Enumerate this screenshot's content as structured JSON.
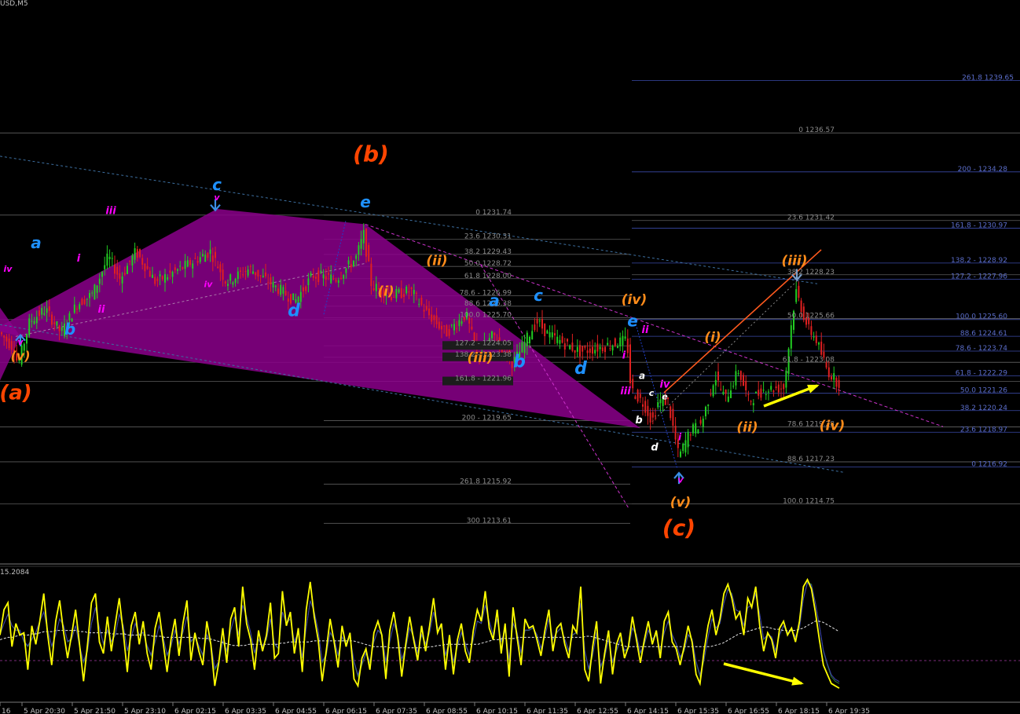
{
  "header": {
    "symbol": "USD,M5",
    "osc_value": "15.2084"
  },
  "colors": {
    "background": "#000000",
    "bull": "#22cc22",
    "bear": "#e02020",
    "fib_line": "#4a5b9e",
    "fib_text": "#5a6cc8",
    "gray_line": "#5c5c5c",
    "wedge": "#8b008b",
    "orange": "#ff8c1a",
    "red_orange": "#ff4500",
    "cyan": "#1e90ff",
    "magenta": "#ff00ff",
    "yellow": "#ffff00",
    "white": "#ffffff"
  },
  "chart_data": {
    "type": "candlestick",
    "instrument_tf": "USD,M5",
    "ylim": [
      1211.5,
      1243.0
    ],
    "x_ticks": [
      "16",
      "5 Apr 20:30",
      "5 Apr 21:50",
      "5 Apr 23:10",
      "6 Apr 02:15",
      "6 Apr 03:35",
      "6 Apr 04:55",
      "6 Apr 06:15",
      "6 Apr 07:35",
      "6 Apr 08:55",
      "6 Apr 10:15",
      "6 Apr 11:35",
      "6 Apr 12:55",
      "6 Apr 14:15",
      "6 Apr 15:35",
      "6 Apr 16:55",
      "6 Apr 18:15",
      "6 Apr 19:35"
    ],
    "price_path": [
      [
        0,
        1224.9
      ],
      [
        20,
        1223.9
      ],
      [
        25,
        1222.9
      ],
      [
        40,
        1225.5
      ],
      [
        60,
        1226.2
      ],
      [
        80,
        1224.8
      ],
      [
        100,
        1226.5
      ],
      [
        120,
        1227.1
      ],
      [
        140,
        1229.3
      ],
      [
        155,
        1228.0
      ],
      [
        175,
        1229.6
      ],
      [
        200,
        1227.8
      ],
      [
        240,
        1228.8
      ],
      [
        270,
        1229.6
      ],
      [
        290,
        1227.8
      ],
      [
        320,
        1228.6
      ],
      [
        350,
        1227.6
      ],
      [
        378,
        1226.7
      ],
      [
        400,
        1228.2
      ],
      [
        430,
        1228.0
      ],
      [
        455,
        1229.2
      ],
      [
        465,
        1230.6
      ],
      [
        475,
        1227.6
      ],
      [
        500,
        1227.0
      ],
      [
        525,
        1227.3
      ],
      [
        545,
        1226.0
      ],
      [
        570,
        1224.8
      ],
      [
        595,
        1225.9
      ],
      [
        610,
        1223.5
      ],
      [
        630,
        1224.7
      ],
      [
        655,
        1223.0
      ],
      [
        685,
        1225.5
      ],
      [
        700,
        1224.7
      ],
      [
        740,
        1223.7
      ],
      [
        770,
        1224.0
      ],
      [
        800,
        1224.4
      ],
      [
        805,
        1221.5
      ],
      [
        822,
        1220.6
      ],
      [
        832,
        1219.6
      ],
      [
        840,
        1220.8
      ],
      [
        852,
        1220.8
      ],
      [
        866,
        1217.5
      ],
      [
        880,
        1219.0
      ],
      [
        895,
        1219.5
      ],
      [
        912,
        1222.3
      ],
      [
        925,
        1220.9
      ],
      [
        942,
        1222.6
      ],
      [
        955,
        1220.8
      ],
      [
        975,
        1221.5
      ],
      [
        1000,
        1221.6
      ],
      [
        1008,
        1224.9
      ],
      [
        1015,
        1227.3
      ],
      [
        1030,
        1225.1
      ],
      [
        1040,
        1224.5
      ],
      [
        1055,
        1222.6
      ],
      [
        1068,
        1221.9
      ]
    ],
    "fibonacci_levels": [
      {
        "label": "261.8 1239.65",
        "value": 1239.65
      },
      {
        "label": "0 1236.57",
        "value": 1236.57
      },
      {
        "label": "200 - 1234.28",
        "value": 1234.28
      },
      {
        "label": "0 1231.74",
        "value": 1231.74
      },
      {
        "label": "23.6 1231.42",
        "value": 1231.42
      },
      {
        "label": "161.8 - 1230.97",
        "value": 1230.97
      },
      {
        "label": "23.6 1230.31",
        "value": 1230.31
      },
      {
        "label": "38.2 1229.43",
        "value": 1229.43
      },
      {
        "label": "138.2 - 1228.92",
        "value": 1228.92
      },
      {
        "label": "50.0 1228.72",
        "value": 1228.72
      },
      {
        "label": "38.2 1228.23",
        "value": 1228.23
      },
      {
        "label": "61.8 1228.00",
        "value": 1228.0
      },
      {
        "label": "127.2 - 1227.96",
        "value": 1227.96
      },
      {
        "label": "78.6 - 1226.99",
        "value": 1226.99
      },
      {
        "label": "88.6 1226.38",
        "value": 1226.38
      },
      {
        "label": "100.0 1225.70",
        "value": 1225.7
      },
      {
        "label": "50.0 1225.66",
        "value": 1225.66
      },
      {
        "label": "100.0 1225.60",
        "value": 1225.6
      },
      {
        "label": "88.6 1224.61",
        "value": 1224.61
      },
      {
        "label": "127.2 - 1224.05",
        "value": 1224.05
      },
      {
        "label": "78.6 - 1223.74",
        "value": 1223.74
      },
      {
        "label": "138.2 - 1223.38",
        "value": 1223.38
      },
      {
        "label": "61.8 - 1223.08",
        "value": 1223.08
      },
      {
        "label": "61.8 - 1222.29",
        "value": 1222.29
      },
      {
        "label": "161.8 - 1221.96",
        "value": 1221.96
      },
      {
        "label": "50.0 1221.26",
        "value": 1221.26
      },
      {
        "label": "38.2 1220.24",
        "value": 1220.24
      },
      {
        "label": "200 - 1219.65",
        "value": 1219.65
      },
      {
        "label": "78.6 1219.28",
        "value": 1219.28
      },
      {
        "label": "23.6 1218.97",
        "value": 1218.97
      },
      {
        "label": "88.6 1217.23",
        "value": 1217.23
      },
      {
        "label": "0 1216.92",
        "value": 1216.92
      },
      {
        "label": "261.8 1215.92",
        "value": 1215.92
      },
      {
        "label": "100.0 1214.75",
        "value": 1214.75
      },
      {
        "label": "300 1213.61",
        "value": 1213.61
      }
    ],
    "wave_labels": [
      {
        "text": "(a)",
        "color": "red_orange",
        "x": 20,
        "p": 1220.9,
        "size": 26
      },
      {
        "text": "(v)",
        "color": "orange",
        "x": 26,
        "p": 1223.2,
        "size": 16
      },
      {
        "text": "v",
        "color": "magenta",
        "x": 26,
        "p": 1224.1,
        "size": 11
      },
      {
        "text": "b",
        "color": "cyan",
        "x": 89,
        "p": 1224.7,
        "size": 20
      },
      {
        "text": "a",
        "color": "cyan",
        "x": 46,
        "p": 1229.8,
        "size": 20
      },
      {
        "text": "iv",
        "color": "magenta",
        "x": 10,
        "p": 1228.4,
        "size": 11
      },
      {
        "text": "ii",
        "color": "magenta",
        "x": 129,
        "p": 1226.0,
        "size": 13
      },
      {
        "text": "i",
        "color": "magenta",
        "x": 100,
        "p": 1229.0,
        "size": 13
      },
      {
        "text": "iii",
        "color": "magenta",
        "x": 141,
        "p": 1231.8,
        "size": 13
      },
      {
        "text": "c",
        "color": "cyan",
        "x": 276,
        "p": 1233.2,
        "size": 20
      },
      {
        "text": "v",
        "color": "magenta",
        "x": 276,
        "p": 1232.6,
        "size": 11
      },
      {
        "text": "iv",
        "color": "magenta",
        "x": 265,
        "p": 1227.5,
        "size": 11
      },
      {
        "text": "d",
        "color": "cyan",
        "x": 374,
        "p": 1225.8,
        "size": 22
      },
      {
        "text": "(b)",
        "color": "red_orange",
        "x": 472,
        "p": 1234.9,
        "size": 28
      },
      {
        "text": "e",
        "color": "cyan",
        "x": 465,
        "p": 1232.2,
        "size": 20
      },
      {
        "text": "(ii)",
        "color": "orange",
        "x": 556,
        "p": 1228.8,
        "size": 17
      },
      {
        "text": "(i)",
        "color": "orange",
        "x": 491,
        "p": 1227.0,
        "size": 17
      },
      {
        "text": "a",
        "color": "cyan",
        "x": 629,
        "p": 1226.4,
        "size": 20
      },
      {
        "text": "c",
        "color": "cyan",
        "x": 685,
        "p": 1226.7,
        "size": 20
      },
      {
        "text": "b",
        "color": "cyan",
        "x": 661,
        "p": 1222.8,
        "size": 22
      },
      {
        "text": "d",
        "color": "cyan",
        "x": 739,
        "p": 1222.4,
        "size": 22
      },
      {
        "text": "(iii)",
        "color": "orange",
        "x": 611,
        "p": 1223.1,
        "size": 17
      },
      {
        "text": "(iv)",
        "color": "orange",
        "x": 807,
        "p": 1226.5,
        "size": 17
      },
      {
        "text": "e",
        "color": "cyan",
        "x": 805,
        "p": 1225.2,
        "size": 20
      },
      {
        "text": "ii",
        "color": "magenta",
        "x": 821,
        "p": 1224.8,
        "size": 13
      },
      {
        "text": "i",
        "color": "magenta",
        "x": 794,
        "p": 1223.3,
        "size": 13
      },
      {
        "text": "iii",
        "color": "magenta",
        "x": 796,
        "p": 1221.2,
        "size": 13
      },
      {
        "text": "a",
        "color": "white",
        "x": 817,
        "p": 1222.1,
        "size": 12
      },
      {
        "text": "c",
        "color": "white",
        "x": 829,
        "p": 1221.1,
        "size": 11
      },
      {
        "text": "e",
        "color": "white",
        "x": 846,
        "p": 1220.9,
        "size": 11
      },
      {
        "text": "iv",
        "color": "magenta",
        "x": 846,
        "p": 1221.6,
        "size": 13
      },
      {
        "text": "b",
        "color": "white",
        "x": 813,
        "p": 1219.5,
        "size": 13
      },
      {
        "text": "d",
        "color": "white",
        "x": 833,
        "p": 1217.9,
        "size": 13
      },
      {
        "text": "i",
        "color": "magenta",
        "x": 865,
        "p": 1218.5,
        "size": 12
      },
      {
        "text": "v",
        "color": "magenta",
        "x": 866,
        "p": 1216.0,
        "size": 11
      },
      {
        "text": "(v)",
        "color": "orange",
        "x": 866,
        "p": 1214.6,
        "size": 17
      },
      {
        "text": "(c)",
        "color": "red_orange",
        "x": 864,
        "p": 1212.9,
        "size": 28
      },
      {
        "text": "(i)",
        "color": "orange",
        "x": 907,
        "p": 1224.3,
        "size": 17
      },
      {
        "text": "(ii)",
        "color": "orange",
        "x": 951,
        "p": 1219.0,
        "size": 17
      },
      {
        "text": "(iii)",
        "color": "orange",
        "x": 1011,
        "p": 1228.8,
        "size": 17
      },
      {
        "text": "(iv)",
        "color": "orange",
        "x": 1059,
        "p": 1219.1,
        "size": 17
      }
    ]
  },
  "oscillator": {
    "yellow": [
      0.5,
      0.72,
      0.78,
      0.4,
      0.6,
      0.5,
      0.52,
      0.2,
      0.58,
      0.42,
      0.62,
      0.86,
      0.5,
      0.24,
      0.62,
      0.8,
      0.52,
      0.3,
      0.5,
      0.72,
      0.42,
      0.1,
      0.42,
      0.78,
      0.86,
      0.44,
      0.34,
      0.66,
      0.36,
      0.6,
      0.82,
      0.52,
      0.18,
      0.58,
      0.7,
      0.42,
      0.62,
      0.34,
      0.2,
      0.56,
      0.7,
      0.44,
      0.18,
      0.46,
      0.64,
      0.32,
      0.6,
      0.8,
      0.28,
      0.52,
      0.36,
      0.24,
      0.62,
      0.42,
      0.06,
      0.26,
      0.56,
      0.26,
      0.64,
      0.74,
      0.4,
      0.92,
      0.6,
      0.46,
      0.2,
      0.54,
      0.36,
      0.5,
      0.78,
      0.3,
      0.34,
      0.88,
      0.58,
      0.7,
      0.34,
      0.56,
      0.18,
      0.72,
      0.96,
      0.66,
      0.46,
      0.1,
      0.36,
      0.64,
      0.44,
      0.22,
      0.58,
      0.4,
      0.52,
      0.12,
      0.06,
      0.3,
      0.38,
      0.2,
      0.52,
      0.62,
      0.5,
      0.12,
      0.54,
      0.7,
      0.48,
      0.14,
      0.42,
      0.66,
      0.46,
      0.28,
      0.58,
      0.36,
      0.58,
      0.82,
      0.52,
      0.6,
      0.2,
      0.5,
      0.16,
      0.46,
      0.6,
      0.36,
      0.26,
      0.54,
      0.72,
      0.62,
      0.88,
      0.56,
      0.46,
      0.72,
      0.34,
      0.6,
      0.14,
      0.74,
      0.48,
      0.24,
      0.64,
      0.56,
      0.58,
      0.46,
      0.32,
      0.54,
      0.72,
      0.36,
      0.56,
      0.6,
      0.42,
      0.3,
      0.58,
      0.52,
      0.92,
      0.2,
      0.1,
      0.4,
      0.62,
      0.08,
      0.34,
      0.54,
      0.16,
      0.42,
      0.52,
      0.3,
      0.4,
      0.66,
      0.46,
      0.26,
      0.46,
      0.62,
      0.42,
      0.54,
      0.3,
      0.62,
      0.7,
      0.44,
      0.38,
      0.24,
      0.4,
      0.58,
      0.44,
      0.16,
      0.08,
      0.36,
      0.58,
      0.72,
      0.5,
      0.64,
      0.86,
      0.94,
      0.82,
      0.64,
      0.7,
      0.5,
      0.82,
      0.74,
      0.92,
      0.58,
      0.36,
      0.52,
      0.46,
      0.3,
      0.56,
      0.62,
      0.5,
      0.56,
      0.44,
      0.62,
      0.92,
      0.98,
      0.9,
      0.7,
      0.46,
      0.24,
      0.16,
      0.08,
      0.06,
      0.04
    ],
    "signal_green": [
      0.5,
      0.6,
      0.68,
      0.58,
      0.54,
      0.54,
      0.44,
      0.4,
      0.46,
      0.52,
      0.62,
      0.7,
      0.54,
      0.4,
      0.5,
      0.64,
      0.58,
      0.44,
      0.46,
      0.58,
      0.4,
      0.26,
      0.36,
      0.6,
      0.74,
      0.56,
      0.42,
      0.54,
      0.44,
      0.5,
      0.68,
      0.58,
      0.36,
      0.48,
      0.6,
      0.5,
      0.52,
      0.4,
      0.32,
      0.44,
      0.58,
      0.48,
      0.32,
      0.4,
      0.54,
      0.42,
      0.52,
      0.66,
      0.44,
      0.48,
      0.4,
      0.32,
      0.5,
      0.42,
      0.2,
      0.26,
      0.44,
      0.36,
      0.54,
      0.66,
      0.5,
      0.76,
      0.66,
      0.52,
      0.34,
      0.46,
      0.4,
      0.46,
      0.64,
      0.42,
      0.38,
      0.7,
      0.6,
      0.64,
      0.44,
      0.52,
      0.3,
      0.56,
      0.8,
      0.7,
      0.54,
      0.26,
      0.32,
      0.52,
      0.46,
      0.32,
      0.48,
      0.42,
      0.48,
      0.26,
      0.14,
      0.24,
      0.34,
      0.26,
      0.44,
      0.54,
      0.5,
      0.26,
      0.44,
      0.6,
      0.5,
      0.28,
      0.38,
      0.56,
      0.48,
      0.34,
      0.5,
      0.42,
      0.52,
      0.7,
      0.56,
      0.56,
      0.32,
      0.44,
      0.26,
      0.4,
      0.52,
      0.42,
      0.32,
      0.46,
      0.62,
      0.6,
      0.76,
      0.62,
      0.5,
      0.64,
      0.44,
      0.54,
      0.28,
      0.6,
      0.52,
      0.34,
      0.54,
      0.54,
      0.56,
      0.5,
      0.38,
      0.48,
      0.64,
      0.46,
      0.52,
      0.56,
      0.46,
      0.36,
      0.5,
      0.52,
      0.78,
      0.36,
      0.2,
      0.32,
      0.52,
      0.22,
      0.3,
      0.46,
      0.26,
      0.36,
      0.46,
      0.36,
      0.38,
      0.56,
      0.5,
      0.34,
      0.42,
      0.54,
      0.46,
      0.5,
      0.36,
      0.52,
      0.62,
      0.5,
      0.42,
      0.3,
      0.36,
      0.5,
      0.46,
      0.26,
      0.14,
      0.28,
      0.48,
      0.64,
      0.56,
      0.6,
      0.78,
      0.9,
      0.86,
      0.72,
      0.7,
      0.58,
      0.74,
      0.76,
      0.86,
      0.68,
      0.46,
      0.5,
      0.48,
      0.36,
      0.5,
      0.58,
      0.52,
      0.54,
      0.48,
      0.56,
      0.82,
      0.96,
      0.94,
      0.78,
      0.58,
      0.36,
      0.24,
      0.14,
      0.1,
      0.08
    ],
    "ma_white": [
      0.46,
      0.47,
      0.48,
      0.48,
      0.49,
      0.5,
      0.5,
      0.5,
      0.51,
      0.51,
      0.52,
      0.53,
      0.53,
      0.53,
      0.54,
      0.54,
      0.54,
      0.54,
      0.54,
      0.54,
      0.53,
      0.53,
      0.52,
      0.52,
      0.52,
      0.52,
      0.52,
      0.52,
      0.51,
      0.51,
      0.51,
      0.51,
      0.5,
      0.5,
      0.5,
      0.5,
      0.5,
      0.5,
      0.49,
      0.49,
      0.49,
      0.48,
      0.48,
      0.48,
      0.48,
      0.48,
      0.48,
      0.48,
      0.48,
      0.48,
      0.47,
      0.47,
      0.47,
      0.46,
      0.45,
      0.44,
      0.43,
      0.42,
      0.41,
      0.41,
      0.41,
      0.41,
      0.42,
      0.42,
      0.42,
      0.42,
      0.42,
      0.42,
      0.42,
      0.42,
      0.43,
      0.43,
      0.44,
      0.44,
      0.44,
      0.44,
      0.44,
      0.44,
      0.45,
      0.45,
      0.45,
      0.45,
      0.45,
      0.45,
      0.45,
      0.45,
      0.45,
      0.45,
      0.45,
      0.44,
      0.43,
      0.42,
      0.41,
      0.4,
      0.4,
      0.4,
      0.4,
      0.39,
      0.39,
      0.39,
      0.39,
      0.39,
      0.39,
      0.39,
      0.39,
      0.39,
      0.39,
      0.4,
      0.4,
      0.41,
      0.41,
      0.42,
      0.42,
      0.42,
      0.42,
      0.42,
      0.42,
      0.42,
      0.42,
      0.42,
      0.43,
      0.44,
      0.45,
      0.46,
      0.46,
      0.47,
      0.47,
      0.47,
      0.47,
      0.48,
      0.48,
      0.48,
      0.48,
      0.48,
      0.48,
      0.48,
      0.48,
      0.48,
      0.48,
      0.48,
      0.48,
      0.48,
      0.48,
      0.48,
      0.48,
      0.48,
      0.49,
      0.49,
      0.48,
      0.47,
      0.46,
      0.45,
      0.44,
      0.43,
      0.42,
      0.41,
      0.4,
      0.4,
      0.4,
      0.4,
      0.4,
      0.4,
      0.4,
      0.4,
      0.4,
      0.4,
      0.4,
      0.4,
      0.4,
      0.4,
      0.4,
      0.4,
      0.4,
      0.4,
      0.4,
      0.4,
      0.4,
      0.4,
      0.41,
      0.42,
      0.43,
      0.45,
      0.47,
      0.49,
      0.51,
      0.52,
      0.53,
      0.54,
      0.55,
      0.56,
      0.57,
      0.57,
      0.56,
      0.55,
      0.55,
      0.54,
      0.54,
      0.54,
      0.54,
      0.55,
      0.56,
      0.58,
      0.6,
      0.62,
      0.62,
      0.61,
      0.59,
      0.57,
      0.55,
      0.53
    ]
  }
}
